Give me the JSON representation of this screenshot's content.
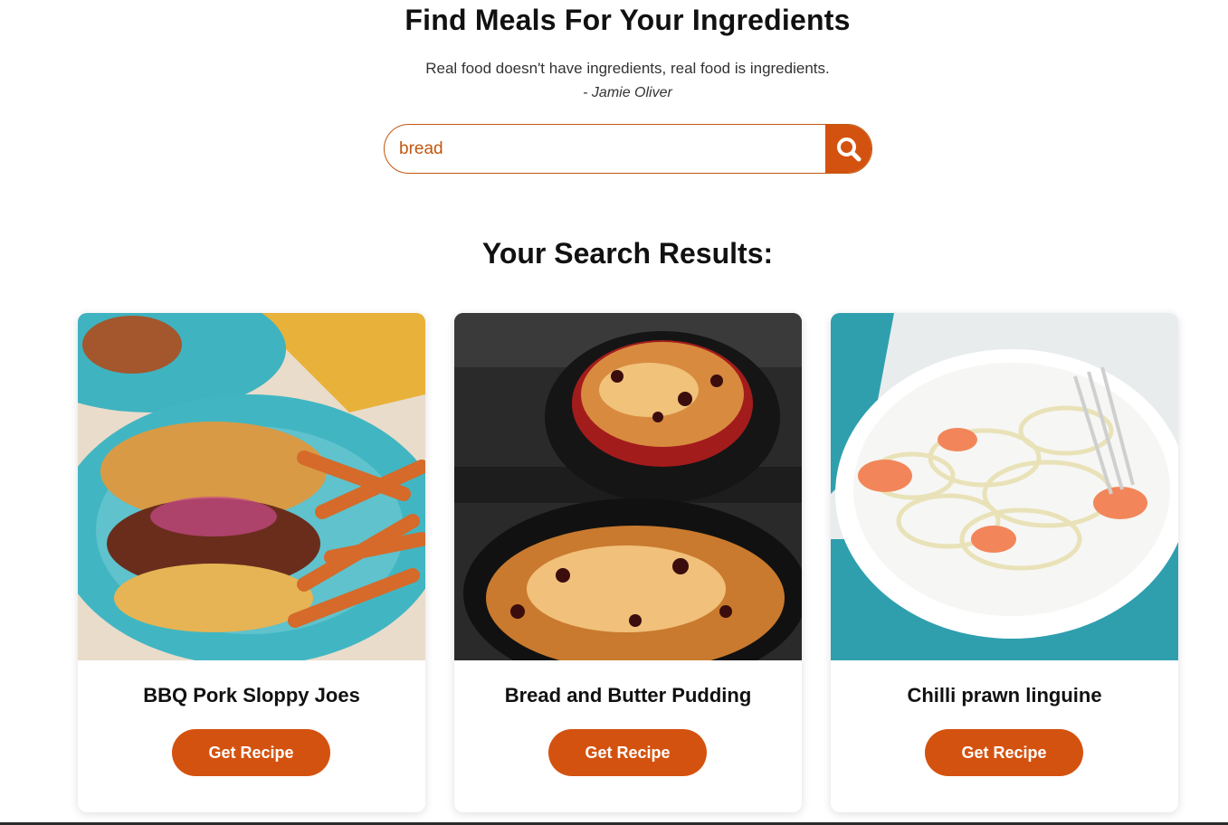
{
  "header": {
    "title": "Find Meals For Your Ingredients",
    "quote": "Real food doesn't have ingredients, real food is ingredients.",
    "author": "- Jamie Oliver"
  },
  "search": {
    "value": "bread",
    "icon": "search-icon"
  },
  "results": {
    "title": "Your Search Results:",
    "cards": [
      {
        "title": "BBQ Pork Sloppy Joes",
        "button": "Get Recipe"
      },
      {
        "title": "Bread and Butter Pudding",
        "button": "Get Recipe"
      },
      {
        "title": "Chilli prawn linguine",
        "button": "Get Recipe"
      }
    ]
  },
  "colors": {
    "accent": "#d4520f",
    "border": "#c2570f",
    "text": "#111111"
  }
}
